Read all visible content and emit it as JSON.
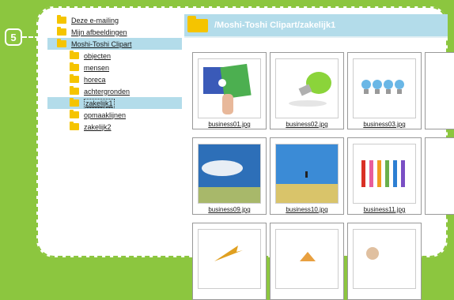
{
  "badge": {
    "number": "5"
  },
  "tree": [
    {
      "label": "Deze e-mailing",
      "level": 0,
      "selected": false
    },
    {
      "label": "Mijn afbeeldingen",
      "level": 0,
      "selected": false
    },
    {
      "label": "Moshi-Toshi Clipart",
      "level": 0,
      "selected": true
    },
    {
      "label": "objecten",
      "level": 1,
      "selected": false
    },
    {
      "label": "mensen",
      "level": 1,
      "selected": false
    },
    {
      "label": "horeca",
      "level": 1,
      "selected": false
    },
    {
      "label": "achtergronden",
      "level": 1,
      "selected": false
    },
    {
      "label": "zakelijk1",
      "level": 1,
      "selected": true
    },
    {
      "label": "opmaaklijnen",
      "level": 1,
      "selected": false
    },
    {
      "label": "zakelijk2",
      "level": 1,
      "selected": false
    }
  ],
  "header": {
    "path": "/Moshi-Toshi Clipart/zakelijk1"
  },
  "thumbnails": [
    {
      "name": "business01.jpg",
      "icon": "puzzle-hand-image"
    },
    {
      "name": "business02.jpg",
      "icon": "green-lightbulb-image"
    },
    {
      "name": "business03.jpg",
      "icon": "blue-lightbulbs-image"
    },
    {
      "name": "business09.jpg",
      "icon": "sky-field-image"
    },
    {
      "name": "business10.jpg",
      "icon": "jumping-person-image"
    },
    {
      "name": "business11.jpg",
      "icon": "colored-pencils-image"
    },
    {
      "name": "",
      "icon": "growth-arrow-image"
    },
    {
      "name": "",
      "icon": "pyramid-image"
    },
    {
      "name": "",
      "icon": "person-image"
    }
  ],
  "colors": {
    "accent": "#8cc63f",
    "selection": "#b3dcea",
    "folder": "#f5c400"
  }
}
